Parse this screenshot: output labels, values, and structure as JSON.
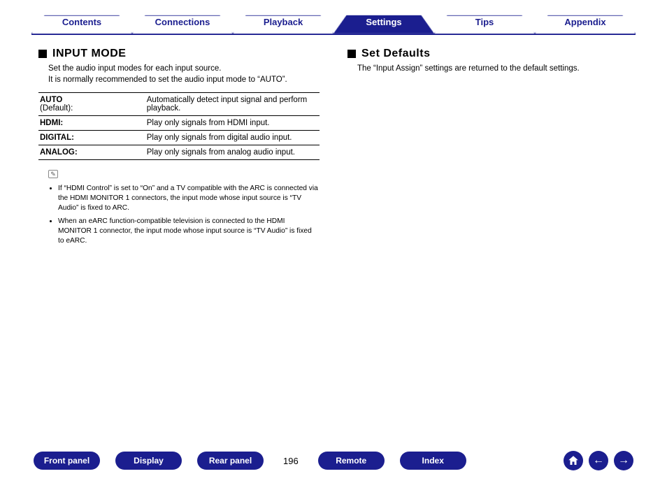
{
  "topnav": {
    "tabs": [
      {
        "label": "Contents"
      },
      {
        "label": "Connections"
      },
      {
        "label": "Playback"
      },
      {
        "label": "Settings"
      },
      {
        "label": "Tips"
      },
      {
        "label": "Appendix"
      }
    ],
    "active_index": 3
  },
  "left": {
    "heading": "INPUT MODE",
    "lead": "Set the audio input modes for each input source.\nIt is normally recommended to set the audio input mode to “AUTO”.",
    "rows": [
      {
        "label": "AUTO",
        "sublabel": "(Default):",
        "desc": "Automatically detect input signal and perform playback."
      },
      {
        "label": "HDMI:",
        "sublabel": "",
        "desc": "Play only signals from HDMI input."
      },
      {
        "label": "DIGITAL:",
        "sublabel": "",
        "desc": "Play only signals from digital audio input."
      },
      {
        "label": "ANALOG:",
        "sublabel": "",
        "desc": "Play only signals from analog audio input."
      }
    ],
    "notes": [
      "If “HDMI Control” is set to “On” and a TV compatible with the ARC is connected via the HDMI MONITOR 1 connectors, the input mode whose input source is “TV Audio” is fixed to ARC.",
      "When an eARC function-compatible television is connected to the HDMI MONITOR 1 connector, the input mode whose input source is “TV Audio” is fixed to eARC."
    ]
  },
  "right": {
    "heading": "Set Defaults",
    "lead": "The “Input Assign” settings are returned to the default settings."
  },
  "bottom": {
    "buttons_left": [
      "Front panel",
      "Display",
      "Rear panel"
    ],
    "page_number": "196",
    "buttons_right": [
      "Remote",
      "Index"
    ]
  }
}
